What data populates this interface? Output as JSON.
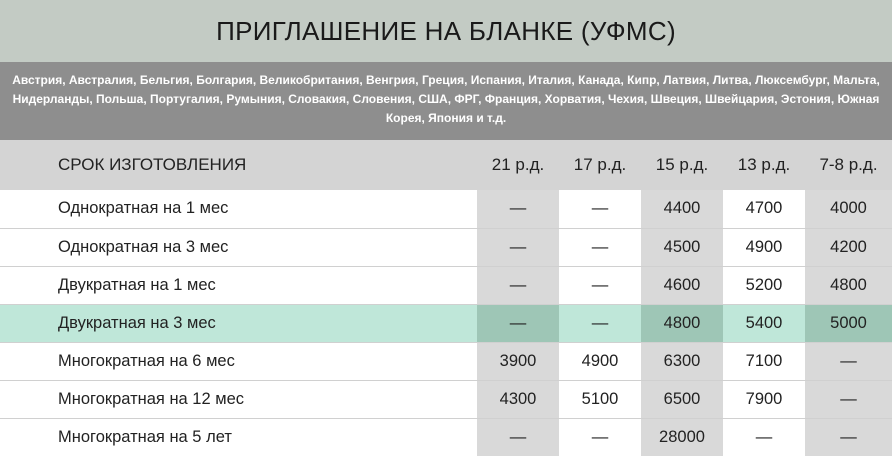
{
  "title": "ПРИГЛАШЕНИЕ НА БЛАНКЕ (УФМС)",
  "countries": "Австрия, Австралия, Бельгия, Болгария, Великобритания, Венгрия, Греция, Испания, Италия, Канада, Кипр, Латвия, Литва, Люксембург, Мальта, Нидерланды, Польша, Португалия, Румыния, Словакия, Словения, США, ФРГ, Франция, Хорватия, Чехия, Швеция, Швейцария, Эстония, Южная Корея, Япония и т.д.",
  "table": {
    "header_label": "СРОК ИЗГОТОВЛЕНИЯ",
    "columns": [
      "21 р.д.",
      "17 р.д.",
      "15 р.д.",
      "13 р.д.",
      "7-8 р.д."
    ],
    "rows": [
      {
        "label": "Однократная на 1 мес",
        "values": [
          "—",
          "—",
          "4400",
          "4700",
          "4000"
        ]
      },
      {
        "label": "Однократная на 3 мес",
        "values": [
          "—",
          "—",
          "4500",
          "4900",
          "4200"
        ]
      },
      {
        "label": "Двукратная на 1 мес",
        "values": [
          "—",
          "—",
          "4600",
          "5200",
          "4800"
        ]
      },
      {
        "label": "Двукратная на 3 мес",
        "values": [
          "—",
          "—",
          "4800",
          "5400",
          "5000"
        ]
      },
      {
        "label": "Многократная на 6 мес",
        "values": [
          "3900",
          "4900",
          "6300",
          "7100",
          "—"
        ]
      },
      {
        "label": "Многократная на 12 мес",
        "values": [
          "4300",
          "5100",
          "6500",
          "7900",
          "—"
        ]
      },
      {
        "label": "Многократная на 5 лет",
        "values": [
          "—",
          "—",
          "28000",
          "—",
          "—"
        ]
      }
    ]
  },
  "colors": {
    "title_bg": "#c3cbc4",
    "countries_bg": "#8e8e8e",
    "header_bg": "#d4d4d4",
    "highlight_row": "#bfe7d9",
    "shaded_cell": "#d9d9d9"
  }
}
